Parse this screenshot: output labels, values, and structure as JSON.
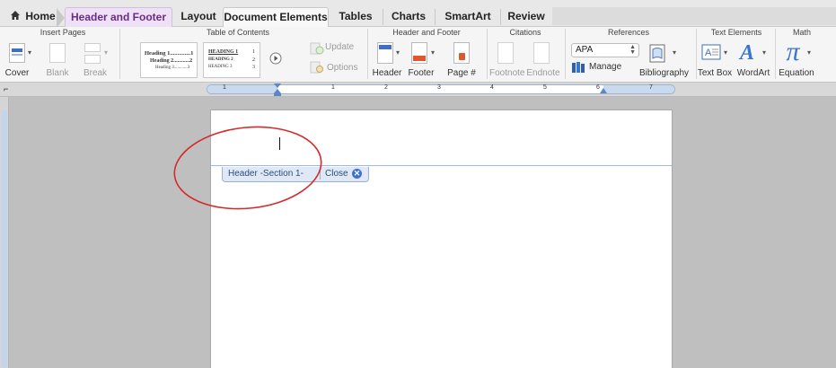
{
  "tabs": {
    "home": "Home",
    "header_footer": "Header and Footer",
    "layout": "Layout",
    "document_elements": "Document Elements",
    "tables": "Tables",
    "charts": "Charts",
    "smartart": "SmartArt",
    "review": "Review",
    "active": "Document Elements",
    "contextual": "Header and Footer",
    "contextual_color": "#6a2b86"
  },
  "ribbon": {
    "groups": {
      "insert_pages": "Insert Pages",
      "toc": "Table of Contents",
      "header_footer": "Header and Footer",
      "citations": "Citations",
      "references": "References",
      "text_elements": "Text Elements",
      "math": "Math"
    },
    "insert_pages": {
      "cover": "Cover",
      "blank": "Blank",
      "break": "Break"
    },
    "toc": {
      "style1": [
        "Heading 1..............1",
        "Heading 2............2",
        "Heading 3............3"
      ],
      "style2": [
        "HEADING 1",
        "HEADING 2",
        "HEADING 3"
      ],
      "style2_nums": [
        "1",
        "2",
        "3"
      ],
      "update": "Update",
      "options": "Options"
    },
    "header_footer": {
      "header": "Header",
      "footer": "Footer",
      "page_num": "Page #"
    },
    "citations": {
      "footnote": "Footnote",
      "endnote": "Endnote"
    },
    "references": {
      "style_value": "APA",
      "manage": "Manage",
      "bibliography": "Bibliography"
    },
    "text_elements": {
      "text_box": "Text Box",
      "wordart": "WordArt"
    },
    "math": {
      "equation": "Equation",
      "pi": "π"
    }
  },
  "ruler": {
    "numbers": [
      "1",
      "1",
      "2",
      "3",
      "4",
      "5",
      "6",
      "7"
    ]
  },
  "document": {
    "header_tab_label": "Header -Section 1-",
    "close_label": "Close",
    "close_icon": "close-circle-icon",
    "accent_color": "#3f72c9"
  },
  "annotation": {
    "shape": "ellipse",
    "color": "#d42a2a"
  }
}
